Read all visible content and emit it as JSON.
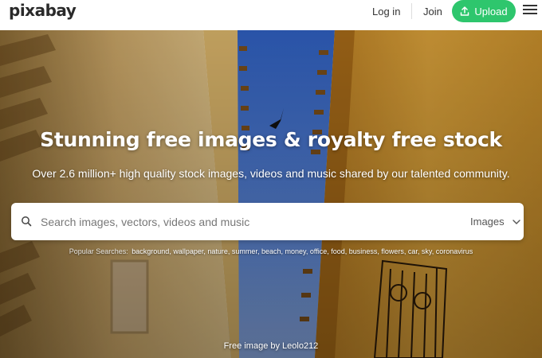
{
  "header": {
    "logo": "pixabay",
    "login_label": "Log in",
    "join_label": "Join",
    "upload_label": "Upload",
    "brand_color": "#2ec66d"
  },
  "hero": {
    "title": "Stunning free images & royalty free stock",
    "subtitle": "Over 2.6 million+ high quality stock images, videos and music shared by our talented community.",
    "search": {
      "placeholder": "Search images, vectors, videos and music",
      "value": "",
      "type_selected": "Images"
    },
    "popular_label": "Popular Searches:",
    "popular_terms": [
      "background",
      "wallpaper",
      "nature",
      "summer",
      "beach",
      "money",
      "office",
      "food",
      "business",
      "flowers",
      "car",
      "sky",
      "coronavirus"
    ],
    "credit": "Free image by Leolo212"
  },
  "icons": {
    "upload": "upload-icon",
    "menu": "hamburger-menu-icon",
    "search": "search-icon",
    "dropdown": "chevron-down-icon"
  }
}
